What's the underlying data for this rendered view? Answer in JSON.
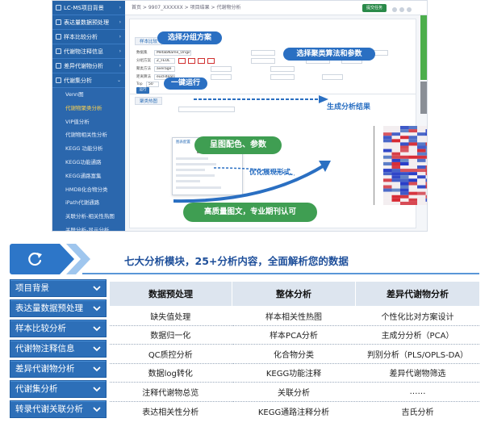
{
  "screenshot": {
    "topbar_path": "首页 > 9907_XXXXXX > 项目结果 > 代谢物分析",
    "topbar_button": "提交任务",
    "sidebar": [
      "LC-MS项目背景",
      "表达量数据预处理",
      "样本比较分析",
      "代谢物注释信息",
      "差异代谢物分析",
      "代谢集分析"
    ],
    "sidebar_sub": [
      "Venn图",
      "代谢物聚类分析",
      "VIP值分析",
      "代谢物相关性分析",
      "KEGG 功能分析",
      "KEGG功能通路",
      "KEGG通路富集",
      "HMDB化合物分类",
      "iPath代谢通路",
      "关联分析-相关性热图",
      "关联分析-显示分析"
    ],
    "tab_label": "样本比较",
    "result_tab": "聚类热图",
    "run_label": "运行",
    "form_labels": [
      "数据集",
      "分组方案",
      "聚类方法",
      "距离算法",
      "Top"
    ],
    "form_values": [
      "MetabName_Origin",
      "Z_FEUL",
      "average",
      "euclidean",
      "50"
    ],
    "dialog_title": "图表配置"
  },
  "callouts": {
    "group_scheme": "选择分组方案",
    "cluster_algo": "选择聚类算法和参数",
    "one_click_run": "一键运行",
    "gen_result": "生成分析结果",
    "color_params": "呈图配色、参数",
    "optimize_form": "优化展现形式",
    "high_quality": "高质量图文，专业期刊认可"
  },
  "banner": {
    "title": "七大分析模块，25+分析内容，全面解析您的数据"
  },
  "modules": [
    "项目背景",
    "表达量数据预处理",
    "样本比较分析",
    "代谢物注释信息",
    "差异代谢物分析",
    "代谢集分析",
    "转录代谢关联分析"
  ],
  "table": {
    "headers": [
      "数据预处理",
      "整体分析",
      "差异代谢物分析"
    ],
    "rows": [
      [
        "缺失值处理",
        "样本相关性热图",
        "个性化比对方案设计"
      ],
      [
        "数据归一化",
        "样本PCA分析",
        "主成分分析（PCA）"
      ],
      [
        "QC质控分析",
        "化合物分类",
        "判别分析（PLS/OPLS-DA）"
      ],
      [
        "数据log转化",
        "KEGG功能注释",
        "差异代谢物筛选"
      ],
      [
        "注释代谢物总览",
        "关联分析",
        "……"
      ],
      [
        "表达相关性分析",
        "KEGG通路注释分析",
        "吉氏分析"
      ]
    ]
  },
  "colors": {
    "primary_blue": "#2d6fb8",
    "callout_blue": "#2a6fc2",
    "callout_green": "#3f9e52",
    "title_blue": "#1e4f9a",
    "header_bg": "#dde5ef"
  }
}
